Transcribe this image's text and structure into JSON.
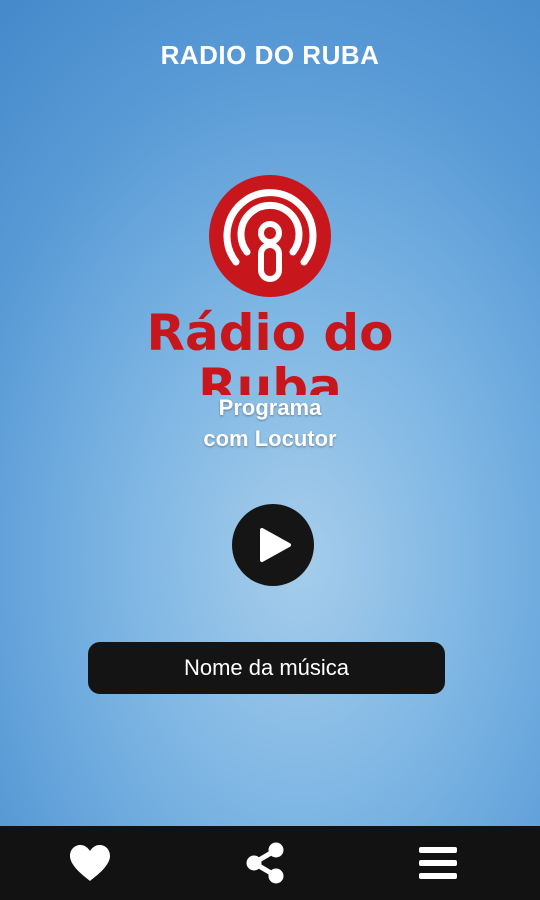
{
  "header": {
    "title": "RADIO DO RUBA"
  },
  "logo": {
    "line1": "Rádio do",
    "line2": "Ruba",
    "icon": "podcast-broadcast-icon",
    "color": "#c8161d"
  },
  "program": {
    "line1": "Programa",
    "line2": "com Locutor"
  },
  "player": {
    "play_icon": "play-icon",
    "song_name": "Nome da música"
  },
  "bottom_nav": {
    "items": [
      {
        "icon": "heart-icon"
      },
      {
        "icon": "share-icon"
      },
      {
        "icon": "menu-icon"
      }
    ]
  }
}
